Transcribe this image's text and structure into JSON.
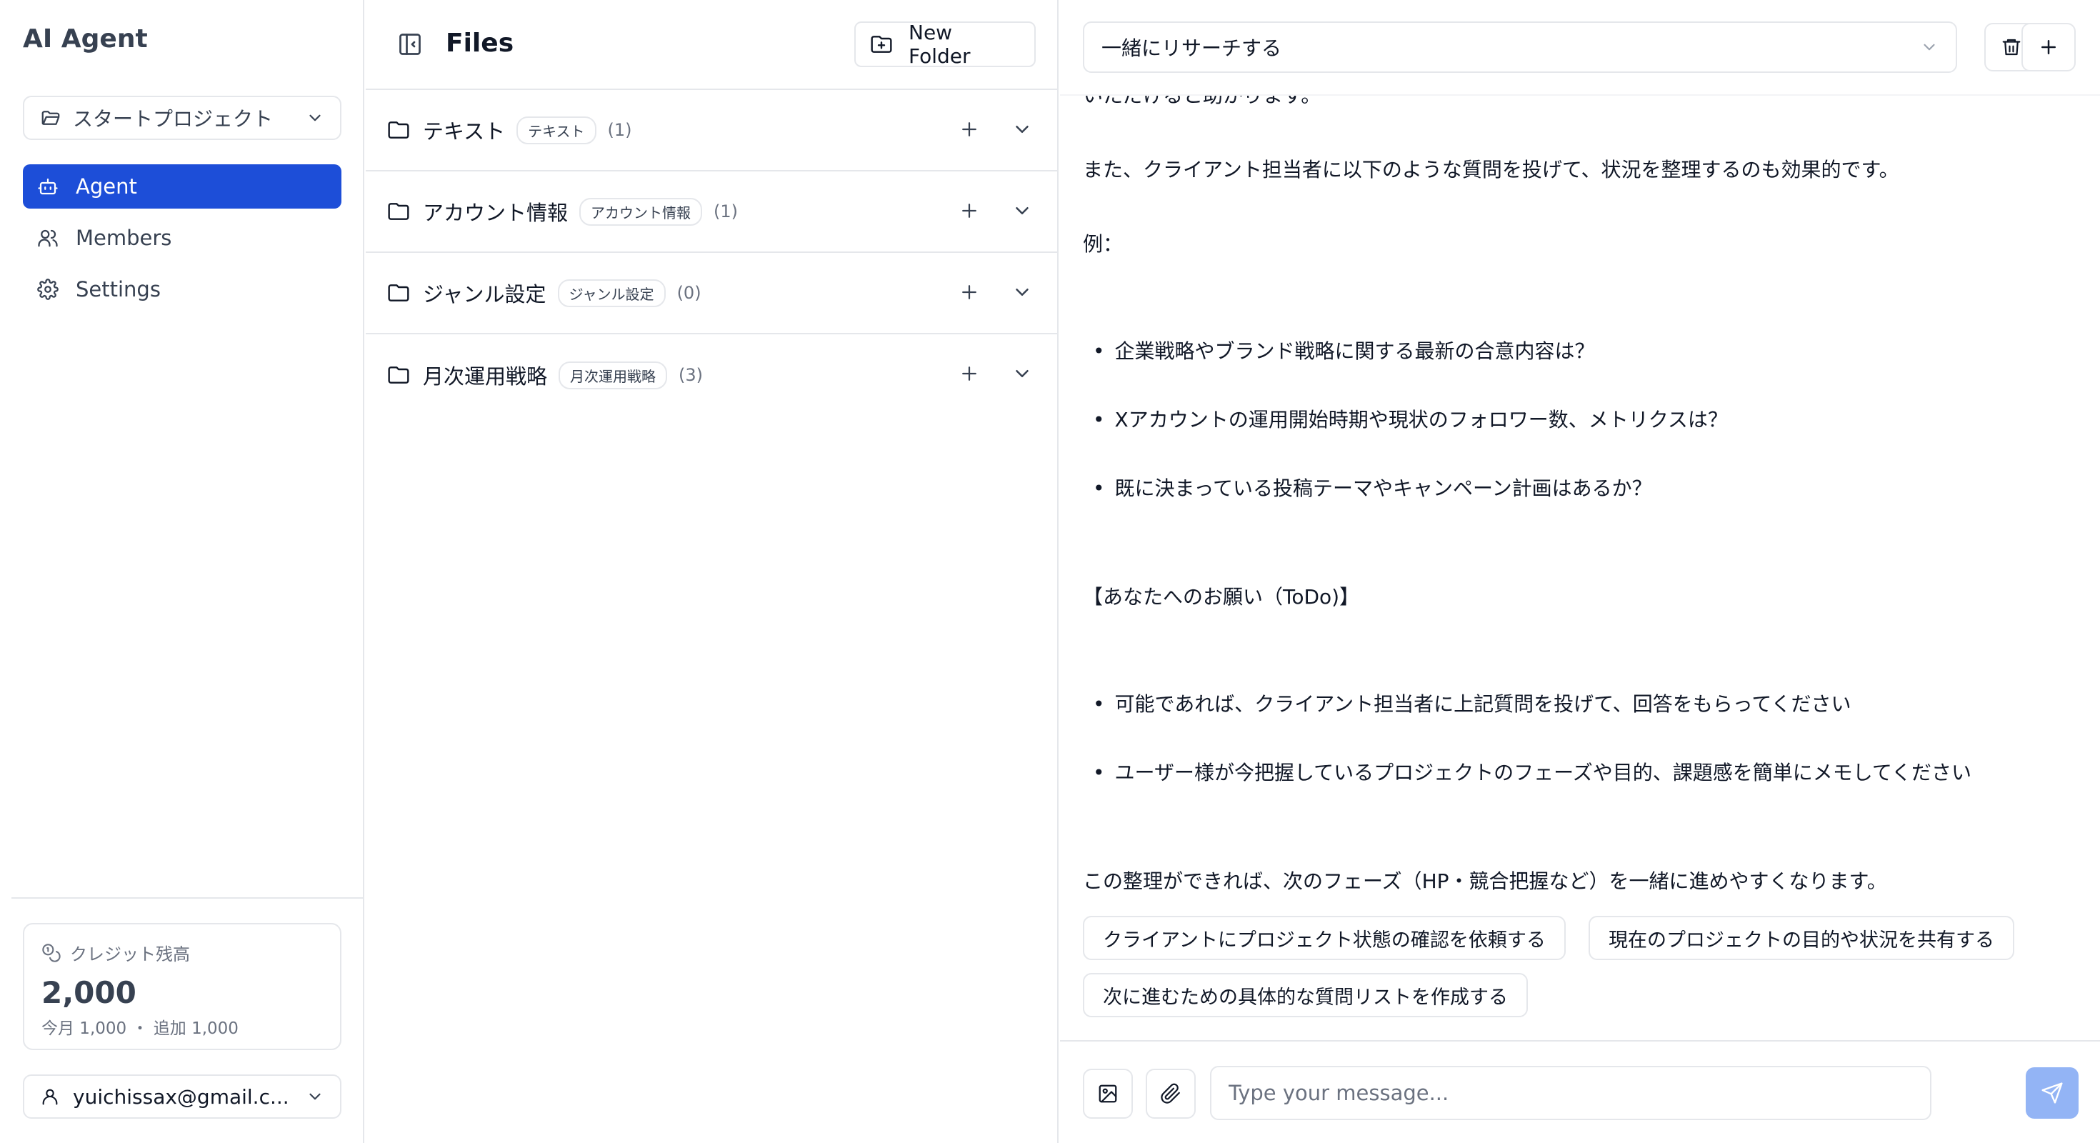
{
  "app": {
    "title": "AI Agent"
  },
  "sidebar": {
    "project_select": {
      "value": "スタートプロジェクト",
      "icon": "folder-open-icon"
    },
    "nav": [
      {
        "label": "Agent",
        "icon": "robot-icon",
        "active": true
      },
      {
        "label": "Members",
        "icon": "users-icon",
        "active": false
      },
      {
        "label": "Settings",
        "icon": "gear-icon",
        "active": false
      }
    ],
    "credit": {
      "label": "クレジット残高",
      "value": "2,000",
      "detail": "今月 1,000 ・ 追加 1,000",
      "icon": "coins-icon"
    },
    "user": {
      "email": "yuichissax@gmail.c...",
      "icon": "user-icon"
    }
  },
  "files": {
    "title": "Files",
    "new_folder_label": "New Folder",
    "folders": [
      {
        "name": "テキスト",
        "tag": "テキスト",
        "count": "(1)"
      },
      {
        "name": "アカウント情報",
        "tag": "アカウント情報",
        "count": "(1)"
      },
      {
        "name": "ジャンル設定",
        "tag": "ジャンル設定",
        "count": "(0)"
      },
      {
        "name": "月次運用戦略",
        "tag": "月次運用戦略",
        "count": "(3)"
      }
    ]
  },
  "chat": {
    "mode": "一緒にリサーチする",
    "messages": {
      "cut_top": "いただけると助かります。",
      "p1": "また、クライアント担当者に以下のような質問を投げて、状況を整理するのも効果的です。",
      "p2": "例：",
      "b1": "企業戦略やブランド戦略に関する最新の合意内容は？",
      "b2": "Xアカウントの運用開始時期や現状のフォロワー数、メトリクスは？",
      "b3": "既に決まっている投稿テーマやキャンペーン計画はあるか？",
      "todo": "【あなたへのお願い（ToDo)】",
      "b4": "可能であれば、クライアント担当者に上記質問を投げて、回答をもらってください",
      "b5": "ユーザー様が今把握しているプロジェクトのフェーズや目的、課題感を簡単にメモしてください",
      "p3": "この整理ができれば、次のフェーズ（HP・競合把握など）を一緒に進めやすくなります。"
    },
    "suggestions": [
      "クライアントにプロジェクト状態の確認を依頼する",
      "現在のプロジェクトの目的や状況を共有する",
      "次に進むための具体的な質問リストを作成する"
    ],
    "input_placeholder": "Type your message...",
    "colors": {
      "accent": "#1d4ed8",
      "send_disabled": "#93b4f5"
    }
  }
}
